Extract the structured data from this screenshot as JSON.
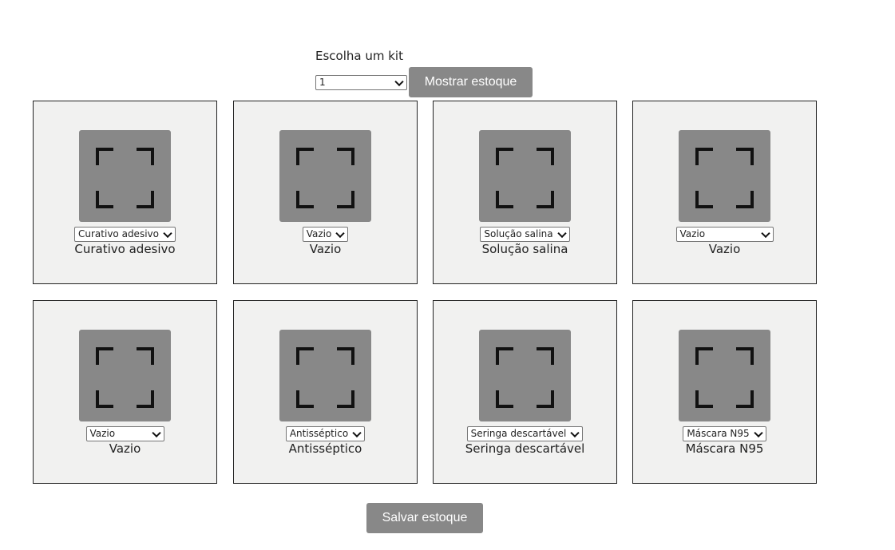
{
  "kit": {
    "label": "Escolha um kit",
    "selected": "1",
    "show_button": "Mostrar estoque"
  },
  "slots": [
    {
      "selected": "Curativo adesivo",
      "name": "Curativo adesivo"
    },
    {
      "selected": "Vazio",
      "name": "Vazio"
    },
    {
      "selected": "Solução salina",
      "name": "Solução salina"
    },
    {
      "selected": "Vazio",
      "name": "Vazio"
    },
    {
      "selected": "Vazio",
      "name": "Vazio"
    },
    {
      "selected": "Antisséptico",
      "name": "Antisséptico"
    },
    {
      "selected": "Seringa descartável",
      "name": "Seringa descartável"
    },
    {
      "selected": "Máscara N95",
      "name": "Máscara N95"
    }
  ],
  "save_button": "Salvar estoque",
  "icons": {
    "thumbnail": "image-placeholder-icon",
    "dropdown": "chevron-down-icon"
  },
  "colors": {
    "button_bg": "#888888",
    "card_bg": "#f1f1f0",
    "thumbnail_bg": "#888888"
  }
}
